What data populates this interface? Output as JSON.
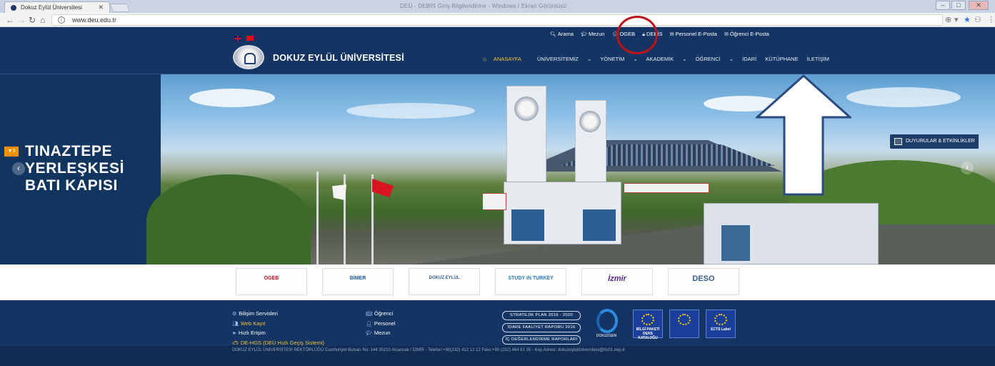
{
  "browser": {
    "tab_title": "Dokuz Eylül Üniversitesi",
    "url": "www.deu.edu.tr",
    "window_title": "DEÜ - DEBİS Giriş Bilgilendirme - Windows / Ekran Görüntüsü"
  },
  "header": {
    "top_links": [
      "Arama",
      "Mezun",
      "OGEB",
      "DEBİS",
      "Personel E-Posta",
      "Öğrenci E-Posta"
    ],
    "university_name": "DOKUZ EYLÜL ÜNİVERSİTESİ",
    "nav": [
      "ANASAYFA",
      "ÜNİVERSİTEMİZ",
      "YÖNETİM",
      "AKADEMİK",
      "ÖĞRENCİ",
      "İDARİ",
      "KÜTÜPHANE",
      "İLETİŞİM"
    ]
  },
  "slider": {
    "caption_lines": [
      "TINAZTEPE",
      "YERLEŞKESİ",
      "BATI KAPISI"
    ],
    "events_label": "DUYURULAR & ETKİNLİKLER"
  },
  "partners": [
    "OGEB",
    "BİMER",
    "DOKUZ EYLÜL",
    "STUDY IN TURKEY",
    "İzmir",
    "DESO"
  ],
  "footer": {
    "col1": [
      "Bilişim Servisleri",
      "Web Kayıt",
      "Hızlı Erişim",
      "DE-HGS (DEÜ Hızlı Geçiş Sistemi)"
    ],
    "col2": [
      "Öğrenci",
      "Personel",
      "Mezun"
    ],
    "reports": [
      "STRATEJİK PLAN 2016 - 2020",
      "İDARE FAALİYET RAPORU 2016",
      "İÇ DEĞERLENDİRME RAPORLARI"
    ],
    "dokuzgen_label": "DOKUZGEN",
    "badges": [
      "BİLGİ PAKETİ DERS KATALOĞU",
      "",
      "ECTS Label"
    ],
    "address": "DOKUZ EYLÜL ÜNİVERSİTESİ REKTÖRLÜĞÜ Cumhuriyet Bulvarı No: 144 35210 Alsancak / İZMİR - Telefon:+90(232) 412 12 12 Faks:+90 (232) 464 81 35 - Kep Adresi: dokuzeylulüniversitesi@hs01.kep.tr"
  },
  "colors": {
    "navy": "#143563",
    "accent": "#f3c23a",
    "annotation": "#c0121a",
    "arrow_outline": "#2b4a7e"
  }
}
